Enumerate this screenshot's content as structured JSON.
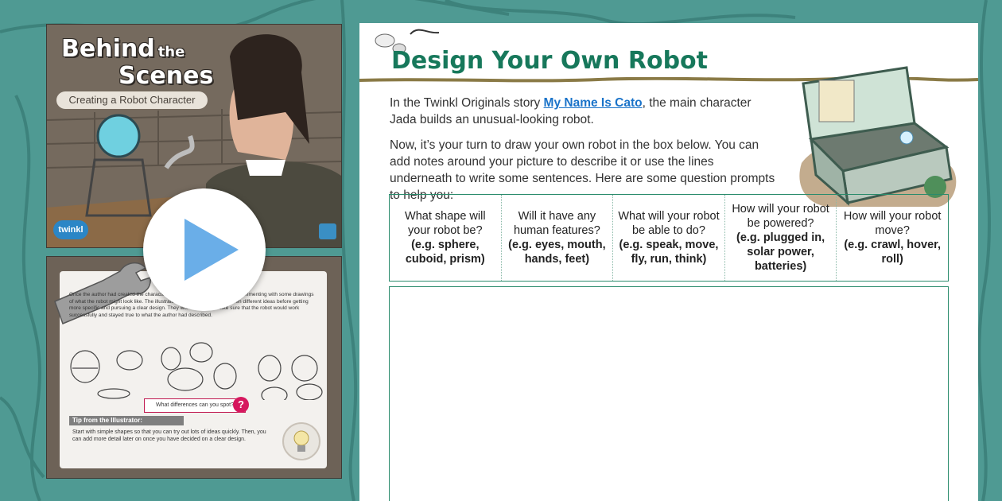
{
  "background": {
    "color": "#4f9a93"
  },
  "preview": {
    "cover": {
      "title_part1": "Behind",
      "title_part2": "the",
      "title_part3": "Scenes",
      "subtitle": "Creating a Robot Character",
      "logo": "twinkl"
    },
    "page2": {
      "body": "Once the author had created the character of Cato, the illustrator began experimenting with some drawings of what the robot might look like. The illustrator came up with at least fifteen different ideas before getting more specific and pursuing a clear design. They worked hard to make sure that the robot would work successfully and stayed true to what the author had described.",
      "question": "What differences can you spot?",
      "question_icon": "?",
      "tip_heading": "Tip from the Illustrator:",
      "tip_body": "Start with simple shapes so that you can try out lots of ideas quickly. Then, you can add more detail later on once you have decided on a clear design."
    },
    "play_icon": "play-icon"
  },
  "worksheet": {
    "title": "Design Your Own Robot",
    "title_color": "#17785b",
    "intro_before_link": "In the Twinkl Originals story ",
    "intro_link": "My Name Is Cato",
    "intro_after_link": ", the main character Jada builds an unusual-looking robot.",
    "intro_2": "Now, it’s your turn to draw your own robot in the box below. You can add notes around your picture to describe it or use the lines underneath to write some sentences. Here are some question prompts to help you:",
    "prompts": [
      {
        "question": "What shape will your robot be?",
        "example": "(e.g. sphere, cuboid, prism)"
      },
      {
        "question": "Will it have any human features?",
        "example": "(e.g. eyes, mouth, hands, feet)"
      },
      {
        "question": "What will your robot be able to do?",
        "example": "(e.g. speak, move, fly, run, think)"
      },
      {
        "question": "How will your robot be powered?",
        "example": "(e.g. plugged in, solar power, batteries)"
      },
      {
        "question": "How will your robot move?",
        "example": "(e.g. crawl, hover, roll)"
      }
    ],
    "box_border_color": "#2a8b6c"
  }
}
